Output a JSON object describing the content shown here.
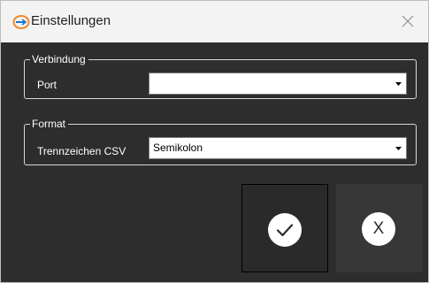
{
  "window": {
    "title": "Einstellungen",
    "app_icon": "app-logo-icon",
    "close_icon": "close-icon"
  },
  "verbindung": {
    "legend": "Verbindung",
    "port_label": "Port",
    "port_value": ""
  },
  "format": {
    "legend": "Format",
    "separator_label": "Trennzeichen CSV",
    "separator_value": "Semikolon"
  },
  "buttons": {
    "ok_icon": "checkmark-icon",
    "cancel_label": "X"
  },
  "colors": {
    "background": "#2d2d2d",
    "titlebar": "#f3f3f3",
    "logo": "#f08a2a"
  }
}
